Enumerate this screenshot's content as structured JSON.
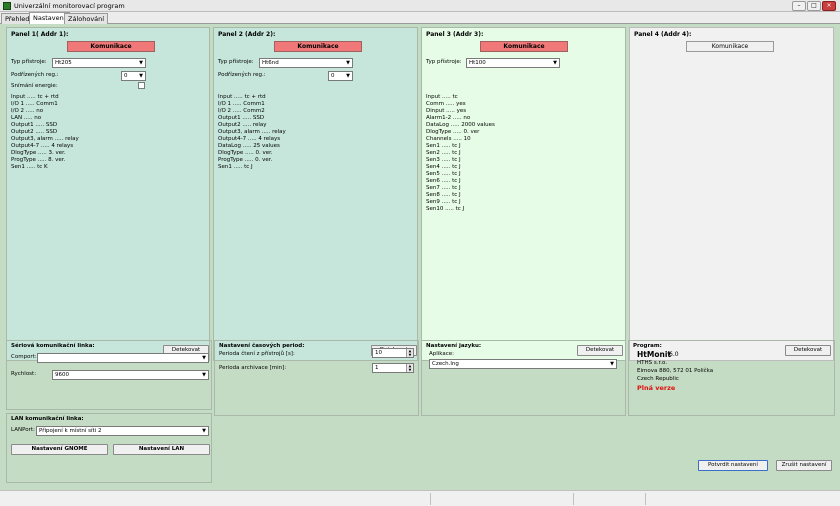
{
  "window": {
    "title": "Univerzální monitorovací program",
    "min": "–",
    "max": "□",
    "close": "×"
  },
  "tabs": [
    {
      "label": "Přehled"
    },
    {
      "label": "Nastavení"
    },
    {
      "label": "Zálohování"
    }
  ],
  "colors": {
    "panel_teal": "#c6e6dc",
    "panel_green": "#e6fce6",
    "panel_gray": "#f1f1f1",
    "komunikace_red": "#f07878"
  },
  "panels": [
    {
      "title": "Panel 1( Addr 1):",
      "komunikace": "Komunikace",
      "typ_label": "Typ přístroje:",
      "typ_value": "Ht205",
      "podr_label": "Podřízených reg.:",
      "podr_value": "0",
      "snimani_label": "Snímání energie:",
      "info": "Input ..... tc + rtd\nI/O 1 ..... Comm1\nI/O 2 ..... no\nLAN ..... no\nOutput1 ..... SSD\nOutput2 ..... SSD\nOutput3, alarm ..... relay\nOutput4-7 ..... 4 relays\nDlogType ..... 3. ver.\nProgType ..... 8. ver.\nSen1 ..... tc K",
      "detekovat": "Detekovat"
    },
    {
      "title": "Panel 2 (Addr 2):",
      "komunikace": "Komunikace",
      "typ_label": "Typ přístroje:",
      "typ_value": "Ht6nd",
      "podr_label": "Podřízených reg.:",
      "podr_value": "0",
      "info": "Input ..... tc + rtd\nI/O 1 ..... Comm1\nI/O 2 ..... Comm2\nOutput1 ..... SSD\nOutput2 ..... relay\nOutput3, alarm ..... relay\nOutput4-7 ..... 4 relays\nDataLog ..... 25 values\nDlogType ..... 0. ver.\nProgType ..... 0. ver.\nSen1 ..... tc J",
      "detekovat": "Detekovat"
    },
    {
      "title": "Panel 3 (Addr 3):",
      "komunikace": "Komunikace",
      "typ_label": "Typ přístroje:",
      "typ_value": "Ht100",
      "info": "Input ..... tc\nComm ..... yes\nDinput ..... yes\nAlarm1-2 ..... no\nDataLog ..... 2000 values\nDlogType ..... 0. ver\nChannels ..... 10\nSen1 ..... tc J\nSen2 ..... tc J\nSen3 ..... tc J\nSen4 ..... tc J\nSen5 ..... tc J\nSen6 ..... tc J\nSen7 ..... tc J\nSen8 ..... tc J\nSen9 ..... tc J\nSen10 ..... tc J",
      "detekovat": "Detekovat"
    },
    {
      "title": "Panel 4 (Addr 4):",
      "komunikace": "Komunikace",
      "detekovat": "Detekovat"
    }
  ],
  "serial": {
    "title": "Sériová komunikační linka:",
    "comport_label": "Comport:",
    "comport_value": "",
    "rychlost_label": "Rychlost:",
    "rychlost_value": "9600"
  },
  "lan": {
    "title": "LAN komunikační linka:",
    "port_label": "LANPort:",
    "port_value": "Připojení k místní síti 2",
    "gnome_btn": "Nastavení GNOME",
    "lan_btn": "Nastavení LAN"
  },
  "periods": {
    "title": "Nastavení časových period:",
    "read_label": "Perioda čtení z přístrojů [s]:",
    "read_value": "10",
    "archive_label": "Perioda archivace [min]:",
    "archive_value": "1",
    "up": "▲",
    "down": "▼"
  },
  "language": {
    "title": "Nastavení jazyku:",
    "app_label": "Aplikace:",
    "app_value": "Czech.lng"
  },
  "program": {
    "title": "Program:",
    "name": "HtMonit",
    "version": "6.0",
    "company": "HTHS s.r.o.",
    "address": "Eimova 880, 572 01 Polička",
    "country": "Czech Republic",
    "edition": "Plná verze"
  },
  "buttons": {
    "confirm": "Potvrdit nastavení",
    "cancel": "Zrušit nastavení"
  },
  "glyphs": {
    "dropdown": "▼"
  }
}
